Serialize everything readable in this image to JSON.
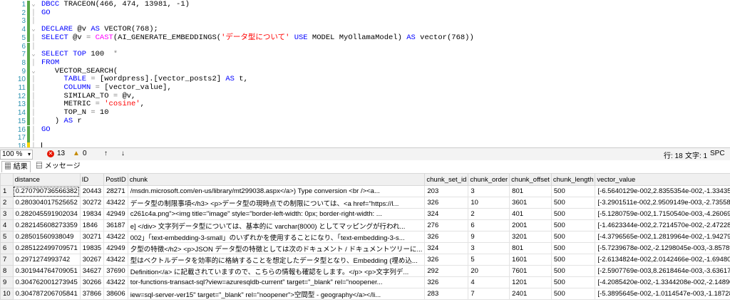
{
  "editor": {
    "lines": [
      {
        "n": "1",
        "parts": [
          [
            "kw",
            "DBCC "
          ],
          [
            "",
            "TRACEON(466, 474, 13981, -1)"
          ]
        ]
      },
      {
        "n": "2",
        "parts": [
          [
            "kw",
            "GO"
          ]
        ]
      },
      {
        "n": "3",
        "parts": []
      },
      {
        "n": "4",
        "parts": [
          [
            "kw",
            "DECLARE "
          ],
          [
            "",
            "@v "
          ],
          [
            "kw",
            "AS "
          ],
          [
            "",
            "VECTOR(768);"
          ]
        ]
      },
      {
        "n": "5",
        "parts": [
          [
            "kw",
            "SELECT "
          ],
          [
            "",
            "@v "
          ],
          [
            "gray",
            "= "
          ],
          [
            "fn",
            "CAST"
          ],
          [
            "",
            "("
          ],
          [
            "",
            "AI_GENERATE_EMBEDDINGS("
          ],
          [
            "str",
            "'データ型について'"
          ],
          [
            "",
            " "
          ],
          [
            "kw",
            "USE "
          ],
          [
            "",
            "MODEL MyOllamaModel) "
          ],
          [
            "kw",
            "AS "
          ],
          [
            "",
            "vector(768))"
          ]
        ]
      },
      {
        "n": "6",
        "parts": []
      },
      {
        "n": "7",
        "parts": [
          [
            "kw",
            "SELECT TOP "
          ],
          [
            "",
            "100 "
          ],
          [
            "gray",
            " *"
          ]
        ]
      },
      {
        "n": "8",
        "parts": [
          [
            "kw",
            "FROM"
          ]
        ]
      },
      {
        "n": "9",
        "parts": [
          [
            "",
            "   VECTOR_SEARCH("
          ]
        ]
      },
      {
        "n": "10",
        "parts": [
          [
            "",
            "     "
          ],
          [
            "kw",
            "TABLE "
          ],
          [
            "gray",
            "= "
          ],
          [
            "",
            "[wordpress].[vector_posts2] "
          ],
          [
            "kw",
            "AS "
          ],
          [
            "",
            "t,"
          ]
        ]
      },
      {
        "n": "11",
        "parts": [
          [
            "",
            "     "
          ],
          [
            "kw",
            "COLUMN "
          ],
          [
            "gray",
            "= "
          ],
          [
            "",
            "[vector_value],"
          ]
        ]
      },
      {
        "n": "12",
        "parts": [
          [
            "",
            "     SIMILAR_TO "
          ],
          [
            "gray",
            "= "
          ],
          [
            "",
            "@v,"
          ]
        ]
      },
      {
        "n": "13",
        "parts": [
          [
            "",
            "     METRIC "
          ],
          [
            "gray",
            "= "
          ],
          [
            "str",
            "'cosine'"
          ],
          [
            "",
            ","
          ]
        ]
      },
      {
        "n": "14",
        "parts": [
          [
            "",
            "     TOP_N "
          ],
          [
            "gray",
            "= "
          ],
          [
            "",
            "10"
          ]
        ]
      },
      {
        "n": "15",
        "parts": [
          [
            "",
            "   ) "
          ],
          [
            "kw",
            "AS "
          ],
          [
            "",
            "r"
          ]
        ]
      },
      {
        "n": "16",
        "parts": [
          [
            "kw",
            "GO"
          ]
        ]
      },
      {
        "n": "17",
        "parts": []
      },
      {
        "n": "18",
        "parts": []
      },
      {
        "n": "19",
        "parts": [
          [
            "green",
            "/*"
          ]
        ]
      }
    ]
  },
  "status": {
    "zoom": "100 %",
    "errors": "13",
    "warnings": "0",
    "row": "行: 18",
    "col": "文字: 1",
    "mode": "SPC"
  },
  "tabs": {
    "results": "結果",
    "messages": "メッセージ"
  },
  "grid": {
    "columns": [
      "",
      "distance",
      "ID",
      "PostID",
      "chunk",
      "chunk_set_id",
      "chunk_order",
      "chunk_offset",
      "chunk_length",
      "vector_value"
    ],
    "rows": [
      [
        "1",
        "0.270790736566382",
        "20443",
        "28271",
        "/msdn.microsoft.com/en-us/library/mt299038.aspx</a>) Type conversion  <br /><a...",
        "203",
        "3",
        "801",
        "500",
        "[-6.5640129e-002,2.8355354e-002,-1.3343536e-002,2..."
      ],
      [
        "2",
        "0.280304017525652",
        "30272",
        "43422",
        "データ型の制限事項</h3>  <p>データ型の現時点での制限については、<a href=\"https://l...",
        "326",
        "10",
        "3601",
        "500",
        "[-3.2901511e-002,2.9509149e-003,-2.7355809e-002,2..."
      ],
      [
        "3",
        "0.282045591902034",
        "19834",
        "42949",
        "c261c4a.png\"><img title=\"image\" style=\"border-left-width: 0px; border-right-width: ...",
        "324",
        "2",
        "401",
        "500",
        "[-5.1280759e-002,1.7150540e-003,-4.2606987e-002,1..."
      ],
      [
        "4",
        "0.282145608273359",
        "1846",
        "36187",
        "e]   </div>  文字列データ型については、基本的に varchar(8000) としてマッピングが行われ...",
        "276",
        "6",
        "2001",
        "500",
        "[-1.4623344e-002,2.7214570e-002,-2.4722811e-002,1..."
      ],
      [
        "5",
        "0.28501560938049",
        "30271",
        "43422",
        "002」「text-embedding-3-small」のいずれかを使用することになり、「text-embedding-3-s...",
        "326",
        "9",
        "3201",
        "500",
        "[-4.3796565e-002,1.2819964e-002,-1.9427992e-002,2..."
      ],
      [
        "6",
        "0.285122499709571",
        "19835",
        "42949",
        "夕型の特徴</h2>  <p>JSON データ型の特徴としては次のドキュメント / ドキュメントツリーに...",
        "324",
        "3",
        "801",
        "500",
        "[-5.7239678e-002,-2.1298045e-003,-3.8578931e-002,1..."
      ],
      [
        "7",
        "0.2971274993742",
        "30267",
        "43422",
        "型はベクトルデータを効率的に格納することを想定したデータ型となり、Embedding (埋め込...",
        "326",
        "5",
        "1601",
        "500",
        "[-2.6134824e-002,2.0142466e-002,-1.6948069e-002,2..."
      ],
      [
        "8",
        "0.301944764709051",
        "34627",
        "37690",
        "Definition</a> に記載されていますので、こちらの情報も確認をします。</p>  <p>文字列デ...",
        "292",
        "20",
        "7601",
        "500",
        "[-2.5907769e-003,8.2618464e-003,-3.6361746e-002,2..."
      ],
      [
        "9",
        "0.304762001273945",
        "30266",
        "43422",
        "tor-functions-transact-sql?view=azuresqldb-current\" target=\"_blank\" rel=\"noopener...",
        "326",
        "4",
        "1201",
        "500",
        "[-4.2085420e-002,-1.3344208e-002,-2.1489060e-002,2..."
      ],
      [
        "10",
        "0.304787206705841",
        "37866",
        "38606",
        "iew=sql-server-ver15\" target=\"_blank\" rel=\"noopener\">空間型 - geography</a></li...",
        "283",
        "7",
        "2401",
        "500",
        "[-5.3895645e-002,-1.0114547e-003,-1.1872823e-002,2..."
      ]
    ]
  }
}
